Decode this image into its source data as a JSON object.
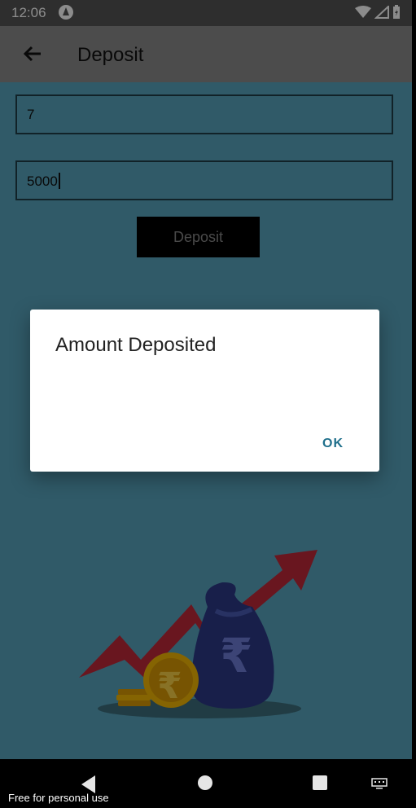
{
  "status_bar": {
    "time": "12:06"
  },
  "toolbar": {
    "title": "Deposit"
  },
  "form": {
    "account_value": "7",
    "amount_value": "5000",
    "deposit_label": "Deposit"
  },
  "dialog": {
    "title": "Amount Deposited",
    "ok_label": "OK"
  },
  "footer": {
    "watermark": "Free for personal use"
  },
  "colors": {
    "app_bg": "#58a5bd",
    "toolbar_bg": "#8a8a8a",
    "dialog_action": "#1f6f8b",
    "arrow_red": "#c0283a",
    "bag_navy": "#2d3a88",
    "coin_gold": "#f2b705"
  },
  "icons": {
    "back": "back-arrow-icon",
    "logo": "a-logo-icon",
    "wifi": "wifi-icon",
    "signal": "signal-icon",
    "battery": "battery-icon",
    "nav_back": "nav-back-icon",
    "nav_home": "nav-home-icon",
    "nav_recents": "nav-recents-icon",
    "keyboard": "keyboard-icon",
    "illustration": "money-growth-illustration"
  }
}
